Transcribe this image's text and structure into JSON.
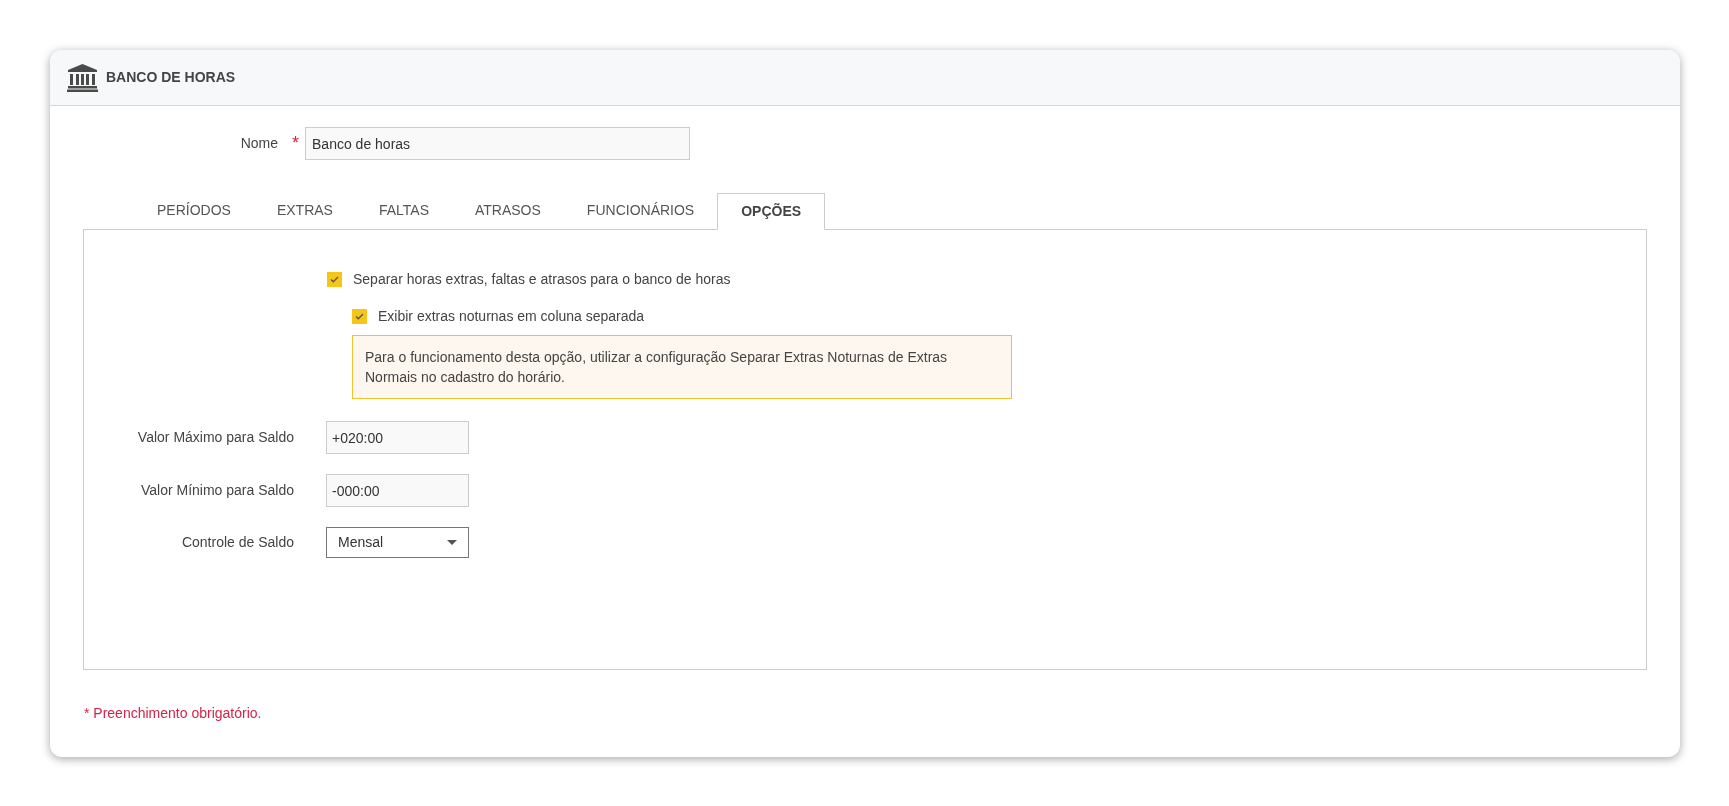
{
  "header": {
    "title": "BANCO DE HORAS"
  },
  "name_field": {
    "label": "Nome",
    "required_mark": "*",
    "value": "Banco de horas"
  },
  "tabs": [
    {
      "label": "PERÍODOS",
      "selected": false
    },
    {
      "label": "EXTRAS",
      "selected": false
    },
    {
      "label": "FALTAS",
      "selected": false
    },
    {
      "label": "ATRASOS",
      "selected": false
    },
    {
      "label": "FUNCIONÁRIOS",
      "selected": false
    },
    {
      "label": "OPÇÕES",
      "selected": true
    }
  ],
  "options": {
    "checkboxes": [
      {
        "label": "Separar horas extras, faltas e atrasos para o banco de horas",
        "checked": true
      },
      {
        "label": "Exibir extras noturnas em coluna separada",
        "checked": true
      }
    ],
    "notice": "Para o funcionamento desta opção, utilizar a configuração Separar Extras Noturnas de Extras Normais no cadastro do horário.",
    "fields": [
      {
        "kind": "text",
        "label": "Valor Máximo para Saldo",
        "value": "+020:00"
      },
      {
        "kind": "text",
        "label": "Valor Mínimo para Saldo",
        "value": "-000:00"
      },
      {
        "kind": "select",
        "label": "Controle de Saldo",
        "value": "Mensal"
      }
    ]
  },
  "footer_note": "* Preenchimento obrigatório."
}
